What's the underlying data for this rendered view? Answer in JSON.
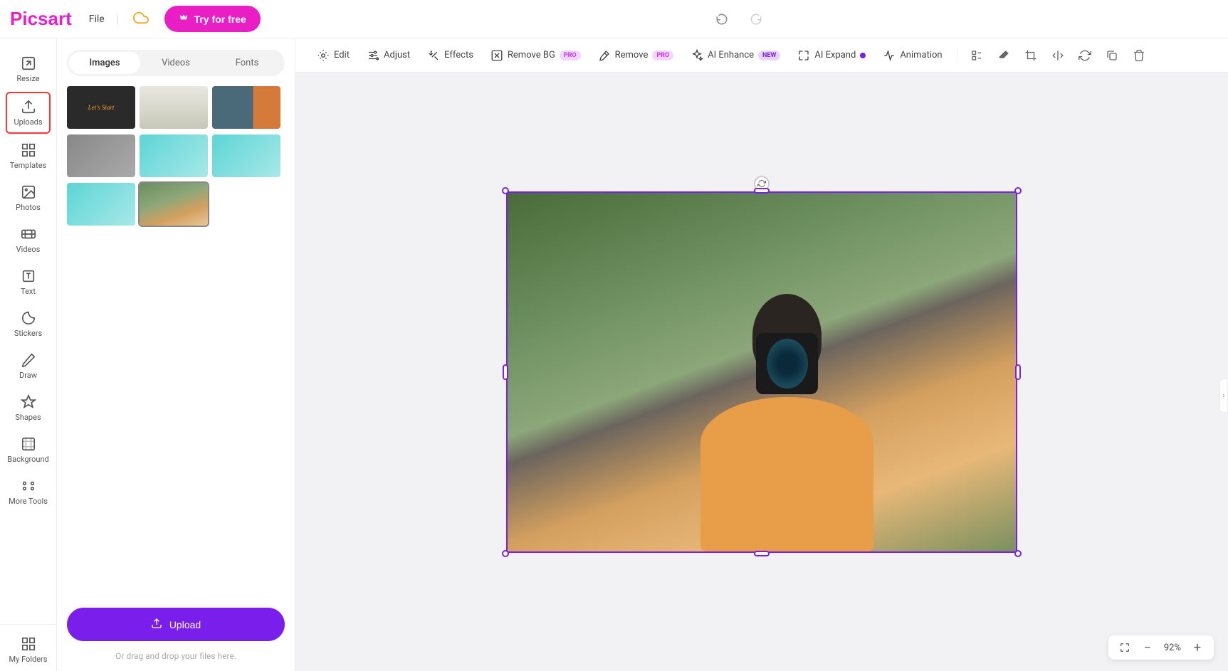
{
  "header": {
    "logo": "Picsart",
    "file_menu": "File",
    "try_button": "Try for free"
  },
  "sidebar": {
    "items": [
      {
        "label": "Resize"
      },
      {
        "label": "Uploads"
      },
      {
        "label": "Templates"
      },
      {
        "label": "Photos"
      },
      {
        "label": "Videos"
      },
      {
        "label": "Text"
      },
      {
        "label": "Stickers"
      },
      {
        "label": "Draw"
      },
      {
        "label": "Shapes"
      },
      {
        "label": "Background"
      },
      {
        "label": "More Tools"
      }
    ],
    "bottom": {
      "label": "My Folders"
    }
  },
  "panel": {
    "tabs": [
      {
        "label": "Images"
      },
      {
        "label": "Videos"
      },
      {
        "label": "Fonts"
      }
    ],
    "thumbnails": {
      "lets_start": "Let's Start"
    },
    "upload_button": "Upload",
    "drag_text": "Or drag and drop your files here."
  },
  "toolbar": {
    "edit": "Edit",
    "adjust": "Adjust",
    "effects": "Effects",
    "remove_bg": "Remove BG",
    "remove": "Remove",
    "ai_enhance": "AI Enhance",
    "ai_expand": "AI Expand",
    "animation": "Animation",
    "badges": {
      "pro": "PRO",
      "new": "NEW"
    }
  },
  "zoom": {
    "percent": "92%"
  }
}
